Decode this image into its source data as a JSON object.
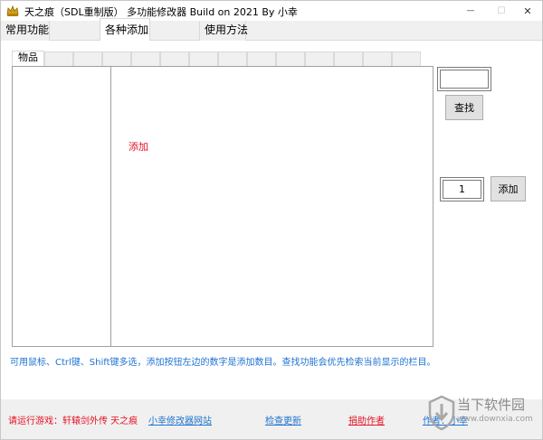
{
  "window": {
    "title": "天之痕（SDL重制版） 多功能修改器  Build on 2021 By 小幸",
    "minimize_glyph": "—",
    "maximize_glyph": "☐",
    "close_glyph": "✕",
    "icon": "crown-icon"
  },
  "tabs": [
    {
      "label": "常用功能",
      "active": false
    },
    {
      "label": "各种添加",
      "active": true
    },
    {
      "label": "使用方法",
      "active": false
    }
  ],
  "inner_tabs": [
    {
      "label": "物品",
      "active": true
    },
    {
      "label": ""
    },
    {
      "label": ""
    },
    {
      "label": ""
    },
    {
      "label": ""
    },
    {
      "label": ""
    },
    {
      "label": ""
    },
    {
      "label": ""
    },
    {
      "label": ""
    },
    {
      "label": ""
    },
    {
      "label": ""
    },
    {
      "label": ""
    },
    {
      "label": ""
    },
    {
      "label": ""
    }
  ],
  "list": {
    "placeholder": "添加"
  },
  "search": {
    "value": "",
    "button_label": "查找"
  },
  "add": {
    "quantity": "1",
    "button_label": "添加"
  },
  "hint": "可用鼠标、Ctrl键、Shift键多选，添加按钮左边的数字是添加数目。查找功能会优先检索当前显示的栏目。",
  "footer": {
    "game": "请运行游戏：轩辕剑外传 天之痕",
    "site_link": "小幸修改器网站",
    "update_link": "检查更新",
    "donate_link": "捐助作者",
    "author_link": "作者：小幸"
  },
  "watermark": {
    "brand": "当下软件园",
    "url": "www.downxia.com"
  },
  "colors": {
    "accent_red": "#e81123",
    "link_blue": "#1e73d2"
  }
}
